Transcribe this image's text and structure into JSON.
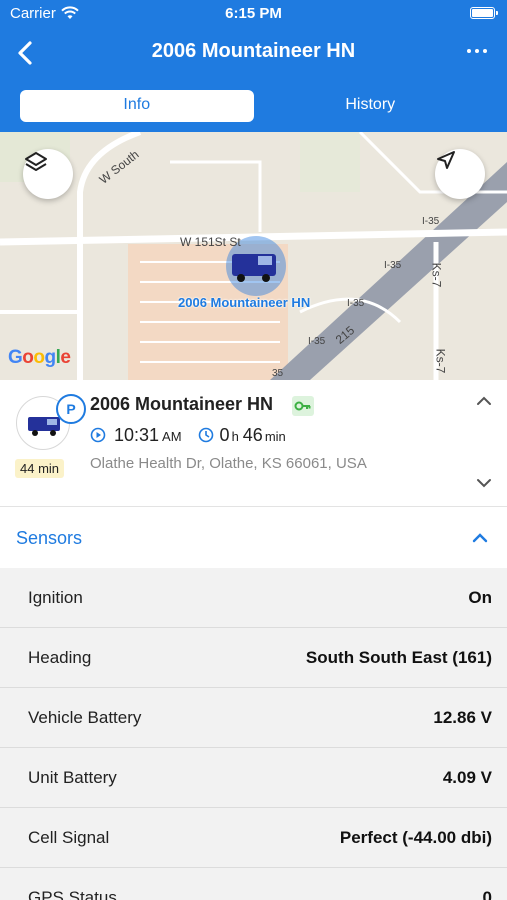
{
  "status_bar": {
    "carrier": "Carrier",
    "time": "6:15 PM"
  },
  "header": {
    "title": "2006 Mountaineer HN",
    "bg_color": "#1f7be0"
  },
  "tabs": [
    {
      "label": "Info",
      "active": true
    },
    {
      "label": "History",
      "active": false
    }
  ],
  "map": {
    "street_labels": [
      "W South",
      "W 151St St",
      "I-35",
      "I-35",
      "I-35",
      "I-35",
      "215",
      "Ks-7",
      "Ks-7",
      "35"
    ],
    "vehicle_label": "2006 Mountaineer HN",
    "attribution": "Google",
    "buttons": {
      "layers": "layers-icon",
      "locate": "navigation-arrow-icon"
    }
  },
  "vehicle": {
    "name": "2006 Mountaineer HN",
    "parking_badge": "P",
    "duration_chip": "44 min",
    "time": "10:31",
    "time_suffix": "AM",
    "elapsed_hours": "0",
    "elapsed_hours_unit": "h",
    "elapsed_minutes": "46",
    "elapsed_minutes_unit": "min",
    "address": "Olathe Health Dr, Olathe, KS 66061, USA",
    "key_icon_color": "#3cb043"
  },
  "sensors": {
    "title": "Sensors",
    "rows": [
      {
        "label": "Ignition",
        "value": "On"
      },
      {
        "label": "Heading",
        "value": "South South East (161)"
      },
      {
        "label": "Vehicle Battery",
        "value": "12.86 V"
      },
      {
        "label": "Unit Battery",
        "value": "4.09 V"
      },
      {
        "label": "Cell Signal",
        "value": "Perfect (-44.00 dbi)"
      },
      {
        "label": "GPS Status",
        "value": "0"
      }
    ]
  }
}
